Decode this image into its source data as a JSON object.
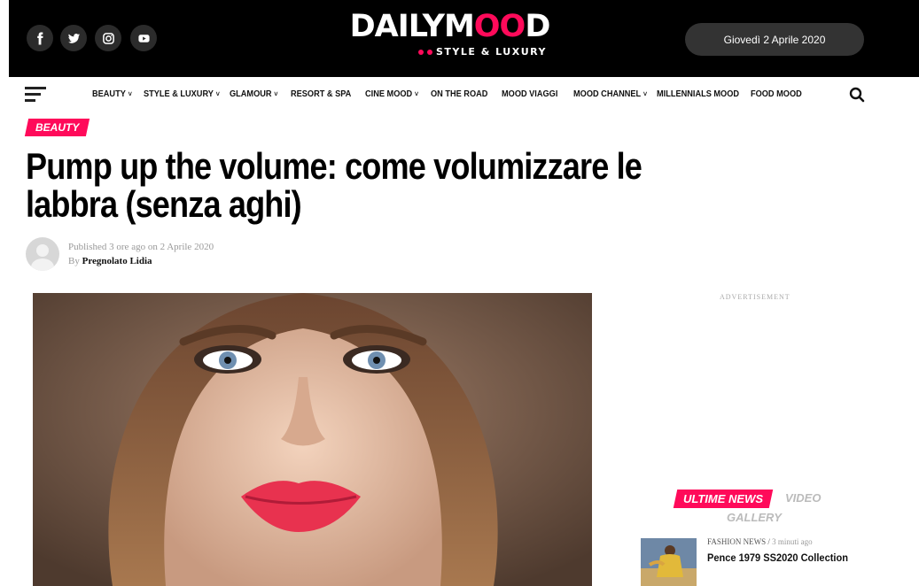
{
  "header": {
    "social": [
      {
        "name": "facebook-icon"
      },
      {
        "name": "twitter-icon"
      },
      {
        "name": "instagram-icon"
      },
      {
        "name": "youtube-icon"
      }
    ],
    "logo_part1": "DAILYM",
    "logo_part2": "OO",
    "logo_part3": "D",
    "tagline": "STYLE & LUXURY",
    "date": "Giovedì 2 Aprile 2020"
  },
  "nav": {
    "items": [
      {
        "label": "BEAUTY",
        "has_dropdown": true
      },
      {
        "label": "STYLE & LUXURY",
        "has_dropdown": true
      },
      {
        "label": "GLAMOUR",
        "has_dropdown": true
      },
      {
        "label": "RESORT & SPA",
        "has_dropdown": false
      },
      {
        "label": "CINE MOOD",
        "has_dropdown": true
      },
      {
        "label": "ON THE ROAD",
        "has_dropdown": false
      },
      {
        "label": "MOOD VIAGGI",
        "has_dropdown": false
      },
      {
        "label": "MOOD CHANNEL",
        "has_dropdown": true
      },
      {
        "label": "MILLENNIALS MOOD",
        "has_dropdown": false
      },
      {
        "label": "FOOD MOOD",
        "has_dropdown": false
      }
    ],
    "chevron": "˅"
  },
  "article": {
    "category": "BEAUTY",
    "title": "Pump up the volume: come volumizzare le labbra (senza aghi)",
    "published": "Published 3 ore ago on 2 Aprile 2020",
    "by_prefix": "By",
    "author": "Pregnolato Lidia"
  },
  "sidebar": {
    "ad_label": "ADVERTISEMENT",
    "tab_active": "ULTIME NEWS",
    "tab_video": "VIDEO",
    "tab_gallery": "GALLERY",
    "news": [
      {
        "category": "FASHION NEWS",
        "time": "3 minuti ago",
        "title": "Pence 1979 SS2020 Collection"
      }
    ]
  },
  "colors": {
    "accent": "#ff0a5a",
    "header_bg": "#000000"
  }
}
